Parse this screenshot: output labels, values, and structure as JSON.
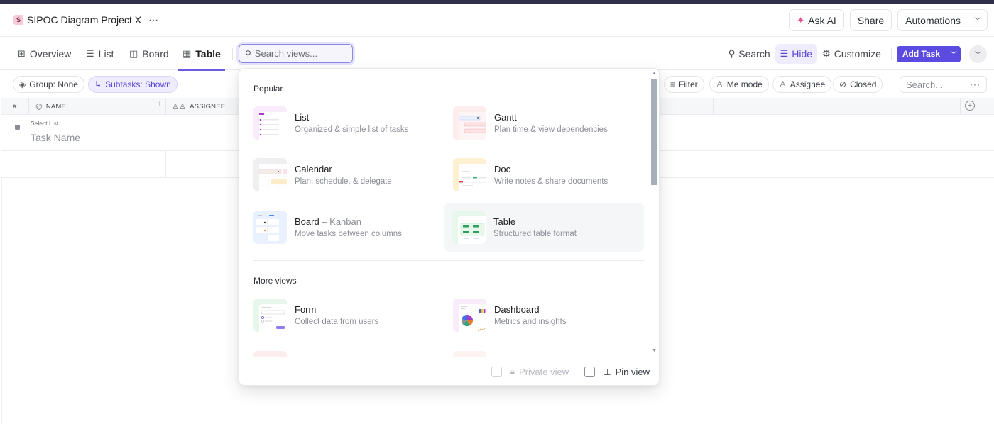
{
  "header": {
    "project_badge": "S",
    "project_title": "SIPOC Diagram Project X",
    "more": "⋯",
    "buttons": {
      "ask_ai": "Ask AI",
      "share": "Share",
      "automations": "Automations"
    }
  },
  "tabs": {
    "items": [
      {
        "label": "Overview",
        "icon": "overview-grid-icon"
      },
      {
        "label": "List",
        "icon": "list-icon"
      },
      {
        "label": "Board",
        "icon": "board-icon"
      },
      {
        "label": "Table",
        "icon": "table-icon",
        "active": true
      }
    ],
    "search_placeholder": "Search views...",
    "right": {
      "search": "Search",
      "hide": "Hide",
      "customize": "Customize",
      "add_task": "Add Task"
    }
  },
  "filters": {
    "group": "Group: None",
    "subtasks": "Subtasks: Shown",
    "filter": "Filter",
    "me_mode": "Me mode",
    "assignee": "Assignee",
    "closed": "Closed",
    "search_placeholder": "Search...",
    "more": "···"
  },
  "table": {
    "columns": [
      "#",
      "NAME",
      "ASSIGNEE"
    ],
    "new_row": {
      "list_placeholder": "Select List...",
      "name_placeholder": "Task Name"
    }
  },
  "popup": {
    "sections": [
      {
        "title": "Popular",
        "views": [
          {
            "name": "List",
            "desc": "Organized & simple list of tasks"
          },
          {
            "name": "Gantt",
            "desc": "Plan time & view dependencies"
          },
          {
            "name": "Calendar",
            "desc": "Plan, schedule, & delegate"
          },
          {
            "name": "Doc",
            "desc": "Write notes & share documents"
          },
          {
            "name": "Board",
            "suffix": " – Kanban",
            "desc": "Move tasks between columns"
          },
          {
            "name": "Table",
            "desc": "Structured table format"
          }
        ]
      },
      {
        "title": "More views",
        "views": [
          {
            "name": "Form",
            "desc": "Collect data from users"
          },
          {
            "name": "Dashboard",
            "desc": "Metrics and insights"
          }
        ]
      }
    ],
    "footer": {
      "private_view": "Private view",
      "pin_view": "Pin view"
    }
  },
  "colors": {
    "accent": "#5b4be0",
    "accent_light": "#efedfd"
  }
}
